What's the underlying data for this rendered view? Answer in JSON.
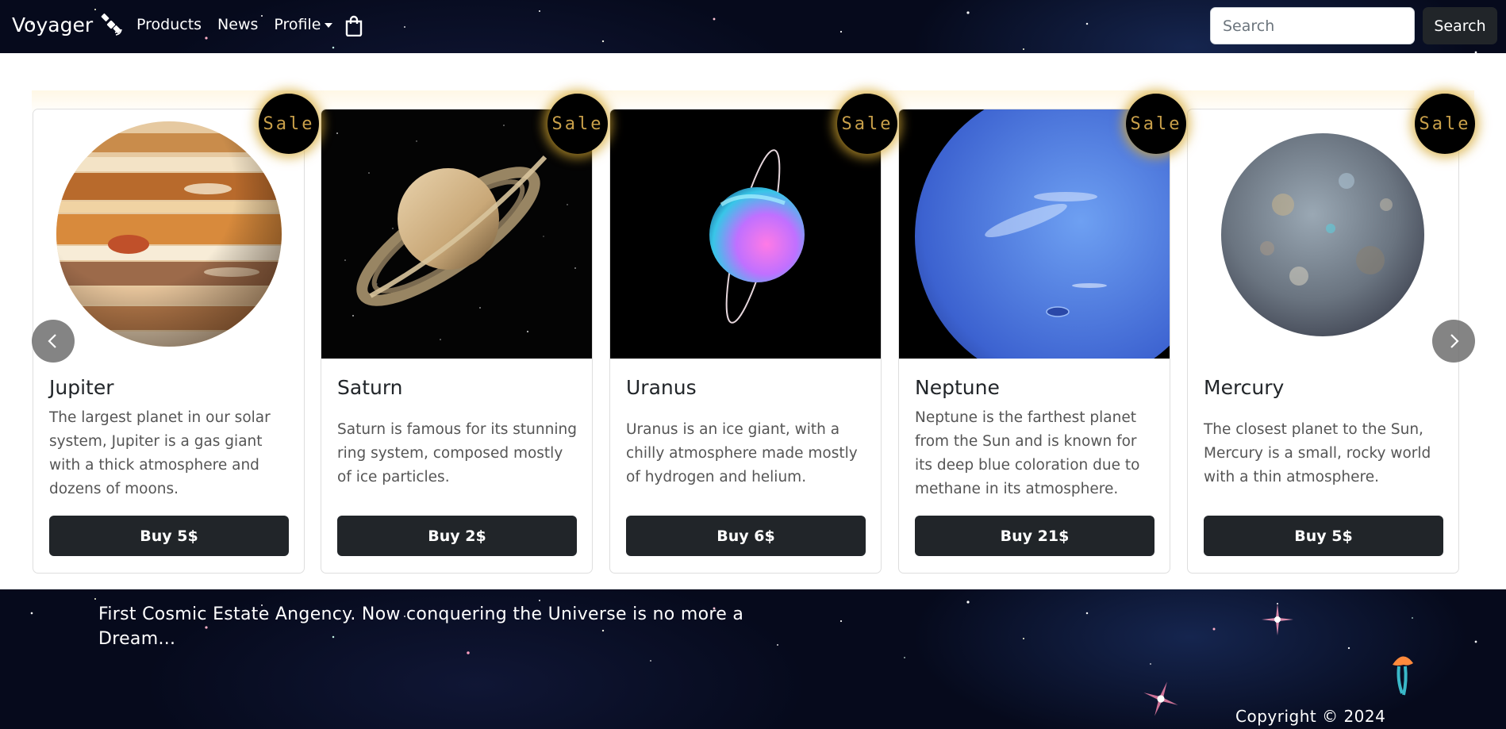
{
  "navbar": {
    "brand": "Voyager",
    "links": [
      {
        "label": "Products"
      },
      {
        "label": "News"
      },
      {
        "label": "Profile"
      }
    ],
    "search_placeholder": "Search",
    "search_button": "Search"
  },
  "carousel": {
    "badge": "Sale",
    "cards": [
      {
        "title": "Jupiter",
        "description": "The largest planet in our solar system, Jupiter is a gas giant with a thick atmosphere and dozens of moons.",
        "button": "Buy 5$"
      },
      {
        "title": "Saturn",
        "description": "Saturn is famous for its stunning ring system, composed mostly of ice particles.",
        "button": "Buy 2$"
      },
      {
        "title": "Uranus",
        "description": "Uranus is an ice giant, with a chilly atmosphere made mostly of hydrogen and helium.",
        "button": "Buy 6$"
      },
      {
        "title": "Neptune",
        "description": "Neptune is the farthest planet from the Sun and is known for its deep blue coloration due to methane in its atmosphere.",
        "button": "Buy 21$"
      },
      {
        "title": "Mercury",
        "description": "The closest planet to the Sun, Mercury is a small, rocky world with a thin atmosphere.",
        "button": "Buy 5$"
      }
    ]
  },
  "footer": {
    "tagline": "First Cosmic Estate Angency. Now conquering the Universe is no more a Dream...",
    "copyright": "Copyright © 2024"
  },
  "colors": {
    "dark_button": "#212529",
    "badge_gold": "#c9a04a",
    "space": "#060a1c"
  }
}
